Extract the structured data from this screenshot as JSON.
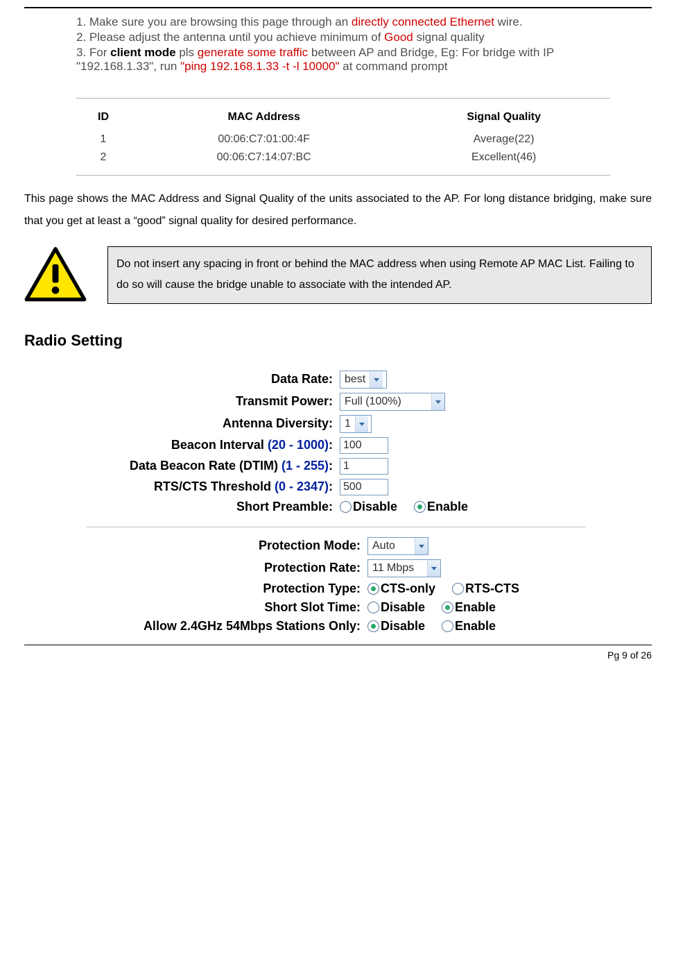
{
  "instructions": {
    "l1_a": "1. Make sure you are browsing this page through an ",
    "l1_b": "directly connected Ethernet",
    "l1_c": " wire.",
    "l2_a": "2. Please adjust the antenna until you achieve minimum of ",
    "l2_b": "Good",
    "l2_c": " signal quality",
    "l3_a": "3. For ",
    "l3_b": "client mode",
    "l3_c": "   pls    ",
    "l3_d": "generate some traffic",
    "l3_e": " between AP and Bridge, Eg: For bridge with IP \"192.168.1.33\", run ",
    "l3_f": "\"ping 192.168.1.33 -t -l 10000\"",
    "l3_g": " at command prompt"
  },
  "sig_table": {
    "headers": {
      "id": "ID",
      "mac": "MAC Address",
      "sq": "Signal Quality"
    },
    "rows": [
      {
        "id": "1",
        "mac": "00:06:C7:01:00:4F",
        "sq": "Average(22)"
      },
      {
        "id": "2",
        "mac": "00:06:C7:14:07:BC",
        "sq": "Excellent(46)"
      }
    ]
  },
  "body_para": "This page shows the MAC Address and Signal Quality of the units associated to the AP. For long distance bridging, make sure that you get at least a “good” signal quality for desired performance.",
  "warning_box": "Do not insert any spacing in front or behind the MAC address when using Remote AP MAC List. Failing to do so will cause the bridge unable to associate with the intended AP.",
  "section_heading": "Radio Setting",
  "radio": {
    "data_rate": {
      "label": "Data Rate:",
      "value": "best"
    },
    "transmit_power": {
      "label": "Transmit Power:",
      "value": "Full (100%)"
    },
    "antenna_div": {
      "label": "Antenna Diversity:",
      "value": "1"
    },
    "beacon_interval": {
      "label_a": "Beacon Interval ",
      "range": "(20 - 1000)",
      "label_b": ":",
      "value": "100"
    },
    "dtim": {
      "label_a": "Data Beacon Rate (DTIM) ",
      "range": "(1 - 255)",
      "label_b": ":",
      "value": "1"
    },
    "rtscts": {
      "label_a": "RTS/CTS Threshold ",
      "range": "(0 - 2347)",
      "label_b": ":",
      "value": "500"
    },
    "short_preamble": {
      "label": "Short Preamble:",
      "disable": "Disable",
      "enable": "Enable"
    },
    "protection_mode": {
      "label": "Protection Mode:",
      "value": "Auto"
    },
    "protection_rate": {
      "label": "Protection Rate:",
      "value": "11 Mbps"
    },
    "protection_type": {
      "label": "Protection Type:",
      "opt1": "CTS-only",
      "opt2": "RTS-CTS"
    },
    "short_slot": {
      "label": "Short Slot Time:",
      "disable": "Disable",
      "enable": "Enable"
    },
    "allow24": {
      "label": "Allow 2.4GHz 54Mbps Stations Only:",
      "disable": "Disable",
      "enable": "Enable"
    }
  },
  "footer": "Pg 9 of 26"
}
